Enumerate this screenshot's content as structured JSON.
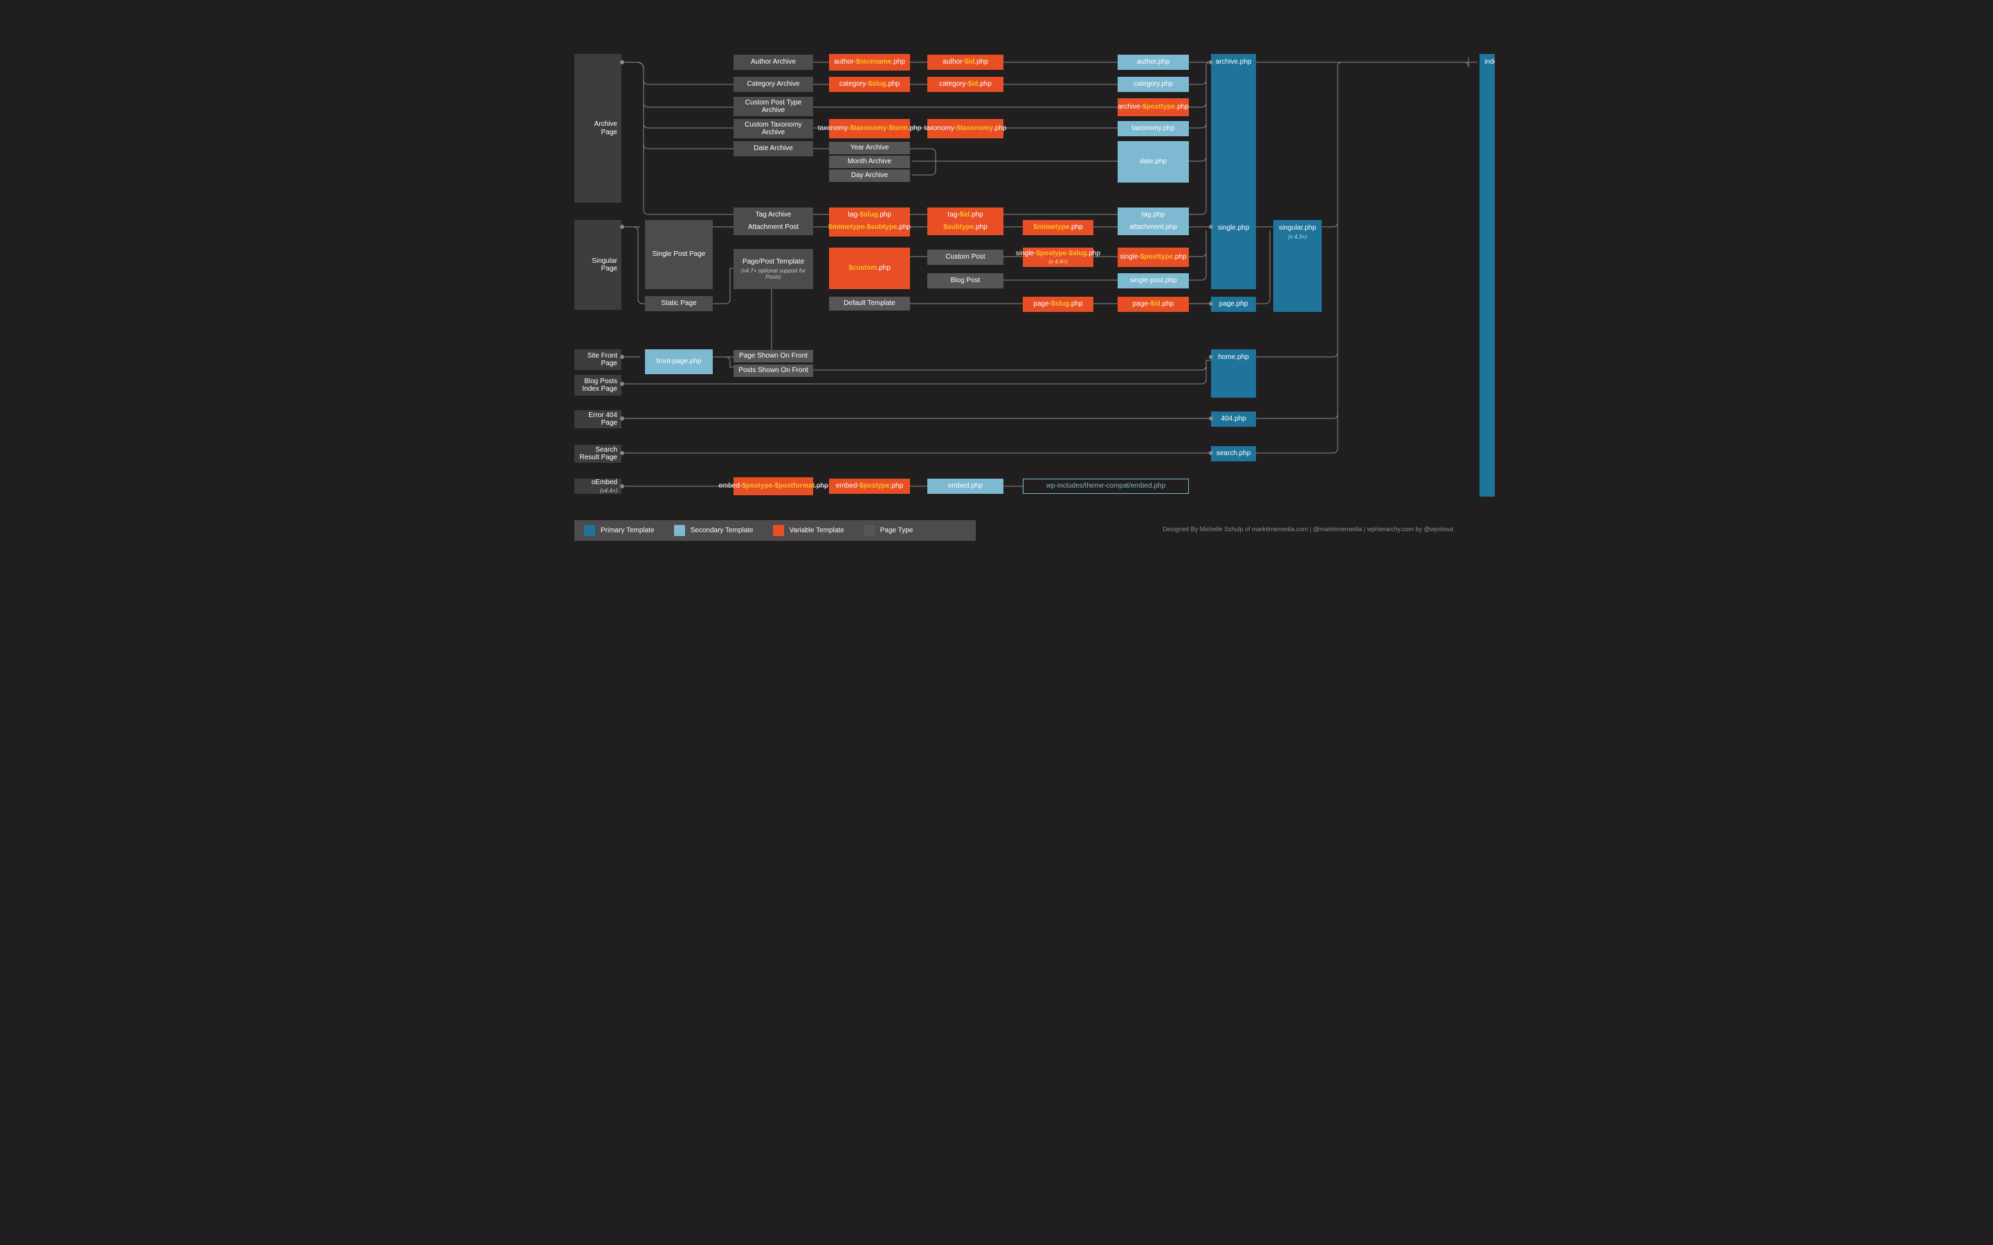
{
  "legend": {
    "primary": "Primary Template",
    "secondary": "Secondary Template",
    "variable": "Variable Template",
    "pagetype": "Page Type"
  },
  "credit": "Designed By Michelle Schulp of marktimemedia.com  |  @marktimemedia  |  wphierarchy.com by @wpshout",
  "col1": {
    "archive": "Archive Page",
    "singular": "Singular Page",
    "front": "Site Front Page",
    "blog": "Blog Posts Index Page",
    "e404": "Error 404 Page",
    "search": "Search Result Page",
    "oembed": "oEmbed",
    "oembed_sub": "(v4.4+)"
  },
  "c2": {
    "single_post": "Single Post Page",
    "static_page": "Static Page",
    "front_page": "front-page.php"
  },
  "c3": {
    "author": "Author Archive",
    "category": "Category Archive",
    "cpt": "Custom Post Type Archive",
    "ctax": "Custom Taxonomy Archive",
    "date": "Date Archive",
    "tag": "Tag Archive",
    "attachment": "Attachment Post",
    "ppt": "Page/Post Template",
    "ppt_sub": "(v4.7+ optional support for Posts)",
    "page_front": "Page Shown On Front",
    "posts_front": "Posts Shown On Front",
    "embed1_pre": "embed-",
    "embed1_var": "$postype-$postformat",
    "embed1_suf": ".php"
  },
  "c4": {
    "author_pre": "author-",
    "author_var": "$nicename",
    "author_suf": ".php",
    "cat_pre": "category-",
    "cat_var": "$slug",
    "cat_suf": ".php",
    "tax_pre": "taxonomy-",
    "tax_var": "$taxonomy-$term",
    "tax_suf": ".php",
    "year": "Year Archive",
    "month": "Month Archive",
    "day": "Day Archive",
    "tag_pre": "tag-",
    "tag_var": "$slug",
    "tag_suf": ".php",
    "mime_var": "$mimetype-$subtype",
    "mime_suf": ".php",
    "custom_var": "$custom",
    "custom_suf": ".php",
    "deftpl": "Default Template",
    "embed2_pre": "embed-",
    "embed2_var": "$postype",
    "embed2_suf": ".php"
  },
  "c5": {
    "author_pre": "author-",
    "author_var": "$id",
    "author_suf": ".php",
    "cat_pre": "category-",
    "cat_var": "$id",
    "cat_suf": ".php",
    "tax_pre": "taxonomy-",
    "tax_var": "$taxonomy",
    "tax_suf": ".php",
    "tag_pre": "tag-",
    "tag_var": "$id",
    "tag_suf": ".php",
    "sub_var": "$subtype",
    "sub_suf": ".php",
    "custom_post": "Custom Post",
    "blog_post": "Blog Post",
    "embed": "embed.php"
  },
  "c6": {
    "mime_var": "$mimetype",
    "mime_suf": ".php",
    "sp_pre": "single-",
    "sp_var": "$postype-$slug",
    "sp_suf": ".php",
    "sp_note": "(v 4.4+)",
    "page_pre": "page-",
    "page_var": "$slug",
    "page_suf": ".php",
    "embed_path": "wp-includes/theme-compat/embed.php"
  },
  "c7": {
    "author": "author.php",
    "category": "category.php",
    "archivept_pre": "archive-",
    "archivept_var": "$posttype",
    "archivept_suf": ".php",
    "taxonomy": "taxonomy.php",
    "date": "date.php",
    "tag": "tag.php",
    "attachment": "attachment.php",
    "singlept_pre": "single-",
    "singlept_var": "$posttype",
    "singlept_suf": ".php",
    "singlepost": "single-post.php",
    "pageid_pre": "page-",
    "pageid_var": "$id",
    "pageid_suf": ".php"
  },
  "c8": {
    "archive": "archive.php",
    "single": "single.php",
    "page": "page.php",
    "home": "home.php",
    "e404": "404.php",
    "search": "search.php"
  },
  "c9": {
    "singular": "singular.php",
    "singular_sub": "(v 4.3+)"
  },
  "c10": {
    "index": "index.php"
  }
}
